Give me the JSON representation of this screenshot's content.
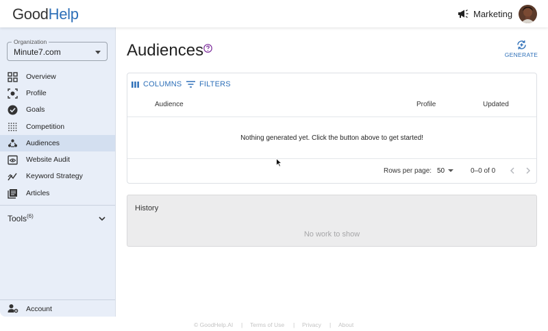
{
  "header": {
    "logo_part1": "Good",
    "logo_part2": "Help",
    "workspace_label": "Marketing"
  },
  "sidebar": {
    "organization_label": "Organization",
    "organization_value": "Minute7.com",
    "items": [
      {
        "label": "Overview",
        "icon": "grid-icon"
      },
      {
        "label": "Profile",
        "icon": "profile-target-icon"
      },
      {
        "label": "Goals",
        "icon": "check-circle-icon"
      },
      {
        "label": "Competition",
        "icon": "dots-grid-icon"
      },
      {
        "label": "Audiences",
        "icon": "group-icon",
        "active": true
      },
      {
        "label": "Website Audit",
        "icon": "browser-eye-icon"
      },
      {
        "label": "Keyword Strategy",
        "icon": "trend-icon"
      },
      {
        "label": "Articles",
        "icon": "articles-icon"
      }
    ],
    "tools_label": "Tools",
    "tools_count": "(6)",
    "account_label": "Account"
  },
  "main": {
    "title": "Audiences",
    "generate_label": "GENERATE",
    "toolbar": {
      "columns_label": "COLUMNS",
      "filters_label": "FILTERS"
    },
    "columns": [
      "Audience",
      "Profile",
      "Updated"
    ],
    "empty_message": "Nothing generated yet. Click the button above to get started!",
    "pagination": {
      "rows_per_page_label": "Rows per page:",
      "rows_per_page_value": "50",
      "range": "0–0 of 0"
    },
    "history": {
      "title": "History",
      "empty_message": "No work to show"
    }
  },
  "footer": {
    "copyright": "© GoodHelp.AI",
    "separator": "|",
    "links": [
      "Terms of Use",
      "Privacy",
      "About"
    ]
  },
  "colors": {
    "brand_blue": "#2d6fb8",
    "sidebar_bg": "#e8eef8",
    "sidebar_active": "#d3dff0",
    "help_icon_purple": "#7b2a9a"
  }
}
